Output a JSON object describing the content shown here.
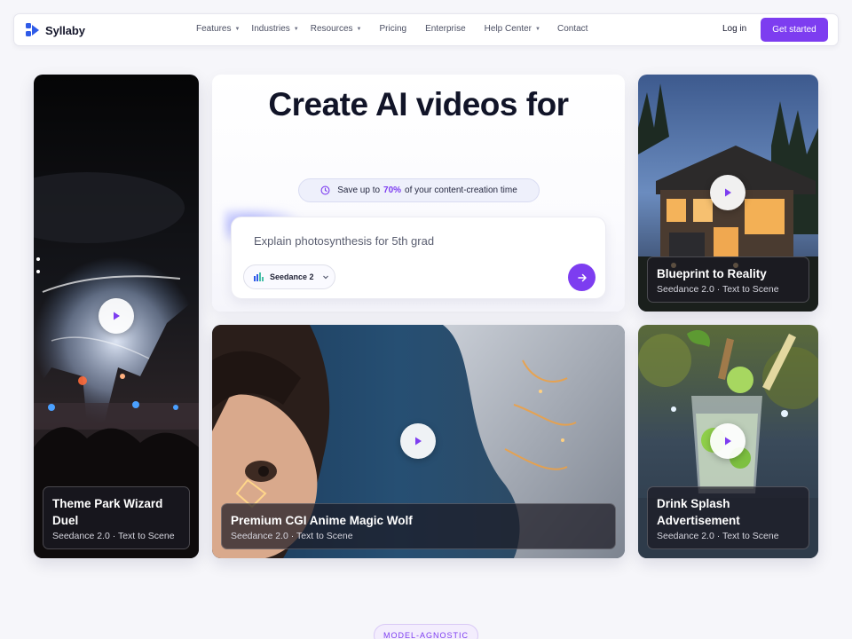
{
  "brand": {
    "name": "Syllaby",
    "accent": "#7d3df0"
  },
  "nav": {
    "items": [
      {
        "label": "Features",
        "dropdown": true
      },
      {
        "label": "Industries",
        "dropdown": true
      },
      {
        "label": "Resources",
        "dropdown": true
      },
      {
        "label": "Pricing",
        "dropdown": false
      },
      {
        "label": "Enterprise",
        "dropdown": false
      },
      {
        "label": "Help Center",
        "dropdown": true
      },
      {
        "label": "Contact",
        "dropdown": false
      }
    ],
    "login": "Log in",
    "cta": "Get started"
  },
  "hero": {
    "title": "Create AI videos for",
    "save_prefix": "Save up to",
    "save_value": "70%",
    "save_suffix": "of your content-creation time",
    "prompt_value": "Explain photosynthesis for 5th grad",
    "model": "Seedance 2"
  },
  "cards": [
    {
      "title": "Theme Park Wizard Duel",
      "subtitle": "Seedance 2.0 · Text to Scene"
    },
    {
      "title": "Blueprint to Reality",
      "subtitle": "Seedance 2.0 · Text to Scene"
    },
    {
      "title": "Premium CGI Anime Magic Wolf",
      "subtitle": "Seedance 2.0 · Text to Scene"
    },
    {
      "title": "Drink Splash Advertisement",
      "subtitle": "Seedance 2.0 · Text to Scene"
    }
  ],
  "section_badge": "MODEL-AGNOSTIC"
}
